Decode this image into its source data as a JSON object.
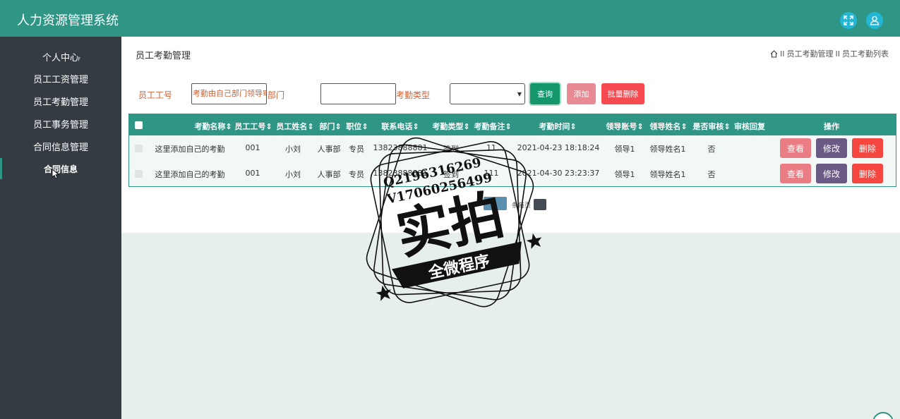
{
  "app": {
    "title": "人力资源管理系统"
  },
  "header": {
    "fullscreen_icon": "fullscreen-icon",
    "user_icon": "user-icon"
  },
  "sidebar": {
    "items": [
      {
        "label": "个人中心"
      },
      {
        "label": "员工工资管理"
      },
      {
        "label": "员工考勤管理"
      },
      {
        "label": "员工事务管理"
      },
      {
        "label": "合同信息管理"
      }
    ],
    "active_sub": {
      "label": "合同信息"
    }
  },
  "page": {
    "title": "员工考勤管理",
    "breadcrumb": {
      "separator": "II",
      "level1": "员工考勤管理",
      "level2": "员工考勤列表"
    }
  },
  "filters": {
    "employee_no_label": "员工工号",
    "employee_no_value": "考勤由自己部门领导审核",
    "department_label": "部门",
    "department_value": "",
    "attendance_type_label": "考勤类型",
    "attendance_type_value": ""
  },
  "toolbar": {
    "query_label": "查询",
    "add_label": "添加",
    "batch_delete_label": "批量删除"
  },
  "table": {
    "headers": {
      "name": "考勤名称",
      "emp_no": "员工工号",
      "emp_name": "员工姓名",
      "dept": "部门",
      "position": "职位",
      "phone": "联系电话",
      "type": "考勤类型",
      "note": "考勤备注",
      "time": "考勤时间",
      "leader_acc": "领导账号",
      "leader_name": "领导姓名",
      "reviewed": "是否审核",
      "reply": "审核回复",
      "actions": "操作"
    },
    "sort_icon": "sort-icon",
    "rows": [
      {
        "name": "这里添加自己的考勤",
        "emp_no": "001",
        "emp_name": "小刘",
        "dept": "人事部",
        "position": "专员",
        "phone": "13823888881",
        "type": "签到",
        "note": "11",
        "time": "2021-04-23 18:18:24",
        "leader_acc": "领导1",
        "leader_name": "领导姓名1",
        "reviewed": "否",
        "reply": ""
      },
      {
        "name": "这里添加自己的考勤",
        "emp_no": "001",
        "emp_name": "小刘",
        "dept": "人事部",
        "position": "专员",
        "phone": "13823888881",
        "type": "签到",
        "note": "111",
        "time": "2021-04-30 23:23:37",
        "leader_acc": "领导1",
        "leader_name": "领导姓名1",
        "reviewed": "否",
        "reply": ""
      }
    ],
    "row_actions": {
      "view": "查看",
      "edit": "修改",
      "delete": "删除"
    }
  },
  "pagination": {
    "per_page_text": "条每页",
    "per_page_value": ""
  },
  "watermark": {
    "line1": "Q2196316269",
    "line2": "V17060256499",
    "main": "实拍",
    "banner": "全微程序"
  },
  "colors": {
    "primary": "#2f9584",
    "sidebar": "#343b42",
    "query": "#14956b",
    "add": "#e88a93",
    "batch_delete": "#f64a51",
    "view": "#ea7c84",
    "edit": "#6b5a86",
    "delete": "#f4473f",
    "icon_button": "#23b7d3"
  }
}
